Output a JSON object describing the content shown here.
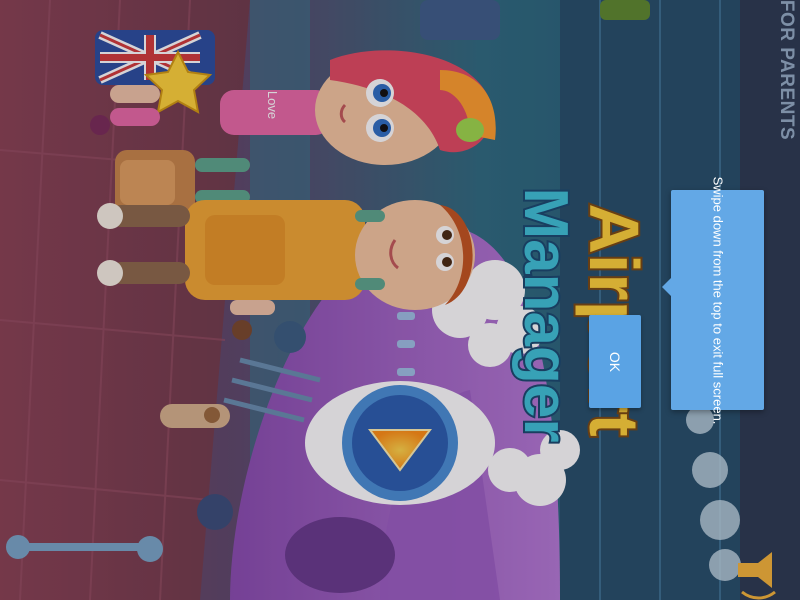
{
  "game": {
    "title_line1": "Airport",
    "title_line2": "Manager",
    "bag_sticker_text": "Love"
  },
  "header": {
    "for_parents_label": "FOR PARENTS"
  },
  "toast": {
    "message": "Swipe down from the top to exit full screen.",
    "ok_label": "OK"
  },
  "icons": {
    "play": "play-icon",
    "sound": "speaker-icon",
    "flag": "union-jack-icon"
  },
  "colors": {
    "toast_bg": "#63a8e6",
    "title_fill": "#ffd23a",
    "play_core": "#ff9d1a"
  }
}
